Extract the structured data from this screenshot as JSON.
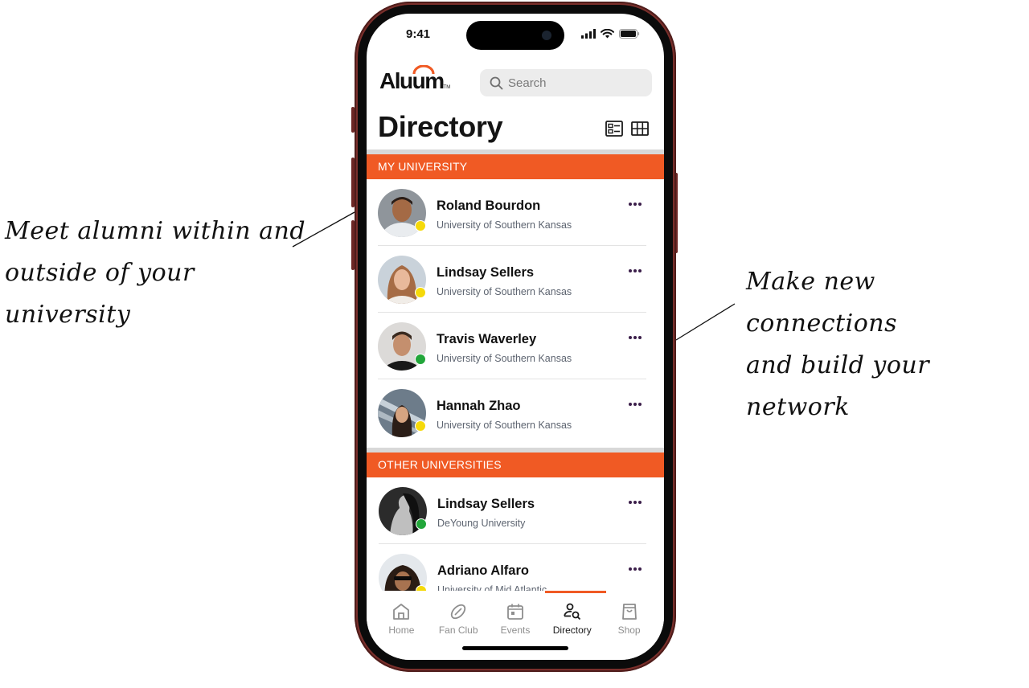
{
  "annotations": {
    "left": [
      "Meet alumni within and",
      "outside of your university"
    ],
    "right": [
      "Make new connections",
      "and build your network"
    ]
  },
  "status_bar": {
    "time": "9:41",
    "icons": [
      "signal-icon",
      "wifi-icon",
      "battery-icon"
    ]
  },
  "header": {
    "logo_text": "Aluum",
    "logo_tm": "TM",
    "search_placeholder": "Search",
    "search_value": ""
  },
  "page": {
    "title": "Directory",
    "view_toggles": [
      "list-view-icon",
      "grid-view-icon"
    ]
  },
  "colors": {
    "accent": "#f05a24",
    "status_away": "#f5d90a",
    "status_online": "#22a63a",
    "menu_dots": "#3b1e4a"
  },
  "sections": [
    {
      "title": "MY UNIVERSITY",
      "members": [
        {
          "name": "Roland Bourdon",
          "university": "University of Southern Kansas",
          "status": "away"
        },
        {
          "name": "Lindsay Sellers",
          "university": "University of Southern Kansas",
          "status": "away"
        },
        {
          "name": "Travis Waverley",
          "university": "University of Southern Kansas",
          "status": "online"
        },
        {
          "name": "Hannah Zhao",
          "university": "University of Southern Kansas",
          "status": "away"
        }
      ]
    },
    {
      "title": "OTHER UNIVERSITIES",
      "members": [
        {
          "name": "Lindsay Sellers",
          "university": "DeYoung University",
          "status": "online"
        },
        {
          "name": "Adriano Alfaro",
          "university": "University of Mid Atlantic",
          "status": "away"
        }
      ]
    }
  ],
  "tab_bar": {
    "active": "Directory",
    "tabs": [
      {
        "label": "Home",
        "icon": "home-icon"
      },
      {
        "label": "Fan Club",
        "icon": "football-icon"
      },
      {
        "label": "Events",
        "icon": "calendar-icon"
      },
      {
        "label": "Directory",
        "icon": "directory-search-icon"
      },
      {
        "label": "Shop",
        "icon": "shopping-bag-icon"
      }
    ]
  }
}
